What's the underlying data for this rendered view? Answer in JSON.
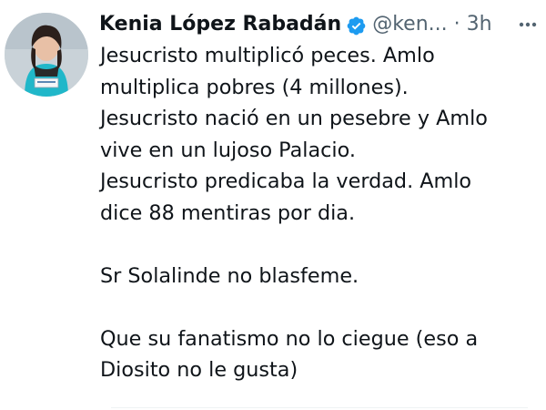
{
  "tweet": {
    "author": {
      "name": "Kenia López Rabadán",
      "handle": "@ken...",
      "verified_color": "#1d9bf0",
      "avatar_icon": "profile-photo"
    },
    "separator": "·",
    "timestamp": "3h",
    "more_icon": "more-options-icon",
    "text_lines": {
      "p1a": "Jesucristo multiplicó peces. Amlo",
      "p1b": "multiplica pobres (4 millones).",
      "p1c": "Jesucristo nació en un pesebre y Amlo",
      "p1d": "vive en un lujoso Palacio.",
      "p1e": "Jesucristo predicaba la verdad. Amlo",
      "p1f": "dice 88 mentiras por dia.",
      "p2": "Sr Solalinde no blasfeme.",
      "p3a": "Que su fanatismo no lo ciegue (eso a",
      "p3b": "Diosito no le gusta)"
    }
  }
}
